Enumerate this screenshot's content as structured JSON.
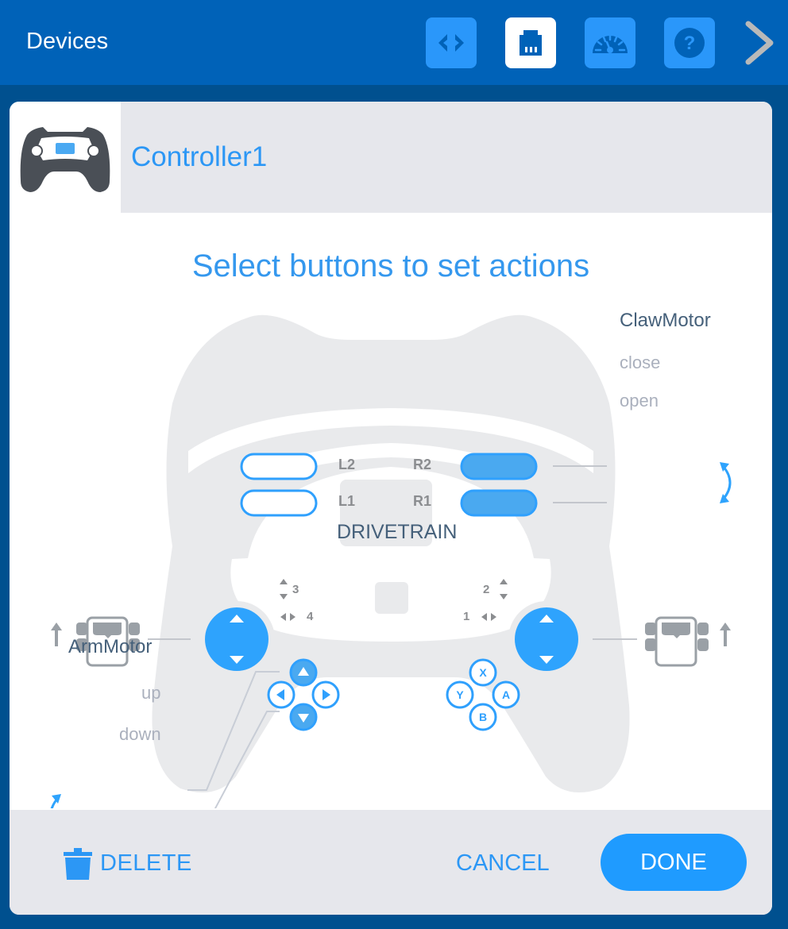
{
  "topbar": {
    "title": "Devices",
    "tools": [
      {
        "name": "code",
        "icon": "code-brackets-icon",
        "active": false
      },
      {
        "name": "devices",
        "icon": "ethernet-port-icon",
        "active": true
      },
      {
        "name": "dashboard",
        "icon": "gauge-icon",
        "active": false
      },
      {
        "name": "help",
        "icon": "help-icon",
        "active": false
      }
    ],
    "next_icon": "chevron-right-icon"
  },
  "device": {
    "icon": "controller-icon",
    "name": "Controller1"
  },
  "instruction": "Select buttons to set actions",
  "controller": {
    "triggers": {
      "L2": {
        "label": "L2",
        "assigned": false
      },
      "L1": {
        "label": "L1",
        "assigned": false
      },
      "R2": {
        "label": "R2",
        "assigned": true
      },
      "R1": {
        "label": "R1",
        "assigned": true
      }
    },
    "axes": {
      "left_vertical": "3",
      "left_horizontal": "4",
      "right_vertical": "2",
      "right_horizontal": "1"
    },
    "screen_label": "DRIVETRAIN",
    "dpad": {
      "up_assigned": true,
      "down_assigned": true,
      "left_assigned": false,
      "right_assigned": false
    },
    "face_buttons": [
      "X",
      "Y",
      "A",
      "B"
    ]
  },
  "claw_motor": {
    "title": "ClawMotor",
    "actions": [
      "close",
      "open"
    ],
    "icon": "rotate-arrows-icon"
  },
  "arm_motor": {
    "title": "ArmMotor",
    "actions": [
      "up",
      "down"
    ],
    "icon": "rotate-arrows-icon"
  },
  "drivetrain": {
    "left_icon": "drivetrain-left-icon",
    "right_icon": "drivetrain-right-icon",
    "direction": "forward"
  },
  "footer": {
    "delete_label": "DELETE",
    "cancel_label": "CANCEL",
    "done_label": "DONE"
  },
  "colors": {
    "accent": "#2c97f5",
    "topbar": "#0062b8",
    "background": "#00508f",
    "controller_body": "#e9eaec",
    "muted_text": "#aab0bd",
    "motor_title": "#45607a"
  }
}
